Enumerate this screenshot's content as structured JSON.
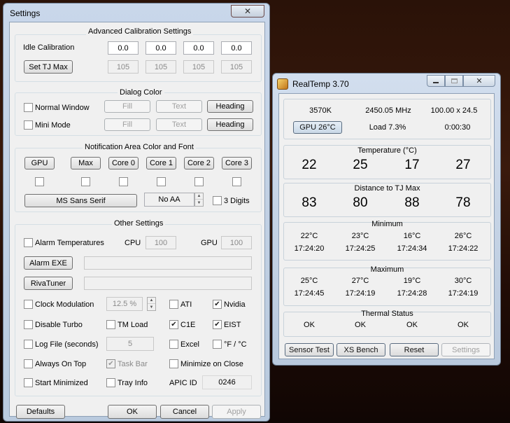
{
  "settings": {
    "title": "Settings",
    "adv": {
      "title": "Advanced Calibration Settings",
      "idle_label": "Idle Calibration",
      "idle_values": [
        "0.0",
        "0.0",
        "0.0",
        "0.0"
      ],
      "tjmax_button": "Set TJ Max",
      "tjmax_values": [
        "105",
        "105",
        "105",
        "105"
      ]
    },
    "dialog": {
      "title": "Dialog Color",
      "normal_window": "Normal Window",
      "mini_mode": "Mini Mode",
      "fill": "Fill",
      "text": "Text",
      "heading": "Heading"
    },
    "notif": {
      "title": "Notification Area Color and Font",
      "buttons": [
        "GPU",
        "Max",
        "Core 0",
        "Core 1",
        "Core 2",
        "Core 3"
      ],
      "font_button": "MS Sans Serif",
      "aa_value": "No AA",
      "three_digits": "3 Digits"
    },
    "other": {
      "title": "Other Settings",
      "alarm_temps": "Alarm Temperatures",
      "cpu_label": "CPU",
      "cpu_value": "100",
      "gpu_label": "GPU",
      "gpu_value": "100",
      "alarm_exe": "Alarm EXE",
      "rivatuner": "RivaTuner",
      "clock_mod": "Clock Modulation",
      "clock_value": "12.5 %",
      "ati": "ATI",
      "nvidia": "Nvidia",
      "disable_turbo": "Disable Turbo",
      "tm_load": "TM Load",
      "c1e": "C1E",
      "eist": "EIST",
      "log_file": "Log File (seconds)",
      "log_value": "5",
      "excel": "Excel",
      "f_c": "°F / °C",
      "always_on_top": "Always On Top",
      "task_bar": "Task Bar",
      "min_on_close": "Minimize on Close",
      "start_minimized": "Start Minimized",
      "tray_info": "Tray Info",
      "apic_label": "APIC ID",
      "apic_value": "0246"
    },
    "footer": {
      "defaults": "Defaults",
      "ok": "OK",
      "cancel": "Cancel",
      "apply": "Apply"
    },
    "checks": {
      "nvidia": true,
      "c1e": true,
      "eist": true,
      "task_bar": true
    }
  },
  "realtemp": {
    "title": "RealTemp 3.70",
    "cpu": "3570K",
    "mhz": "2450.05 MHz",
    "multi": "100.00 x 24.5",
    "gpu_button": "GPU  26°C",
    "load": "Load  7.3%",
    "time": "0:00:30",
    "temp_title": "Temperature (°C)",
    "temps": [
      "22",
      "25",
      "17",
      "27"
    ],
    "dist_title": "Distance to TJ Max",
    "dists": [
      "83",
      "80",
      "88",
      "78"
    ],
    "min_title": "Minimum",
    "min_temps": [
      "22°C",
      "23°C",
      "16°C",
      "26°C"
    ],
    "min_times": [
      "17:24:20",
      "17:24:25",
      "17:24:34",
      "17:24:22"
    ],
    "max_title": "Maximum",
    "max_temps": [
      "25°C",
      "27°C",
      "19°C",
      "30°C"
    ],
    "max_times": [
      "17:24:45",
      "17:24:19",
      "17:24:28",
      "17:24:19"
    ],
    "thermal_title": "Thermal Status",
    "thermal": [
      "OK",
      "OK",
      "OK",
      "OK"
    ],
    "buttons": {
      "sensor": "Sensor Test",
      "xs": "XS Bench",
      "reset": "Reset",
      "settings": "Settings"
    }
  }
}
